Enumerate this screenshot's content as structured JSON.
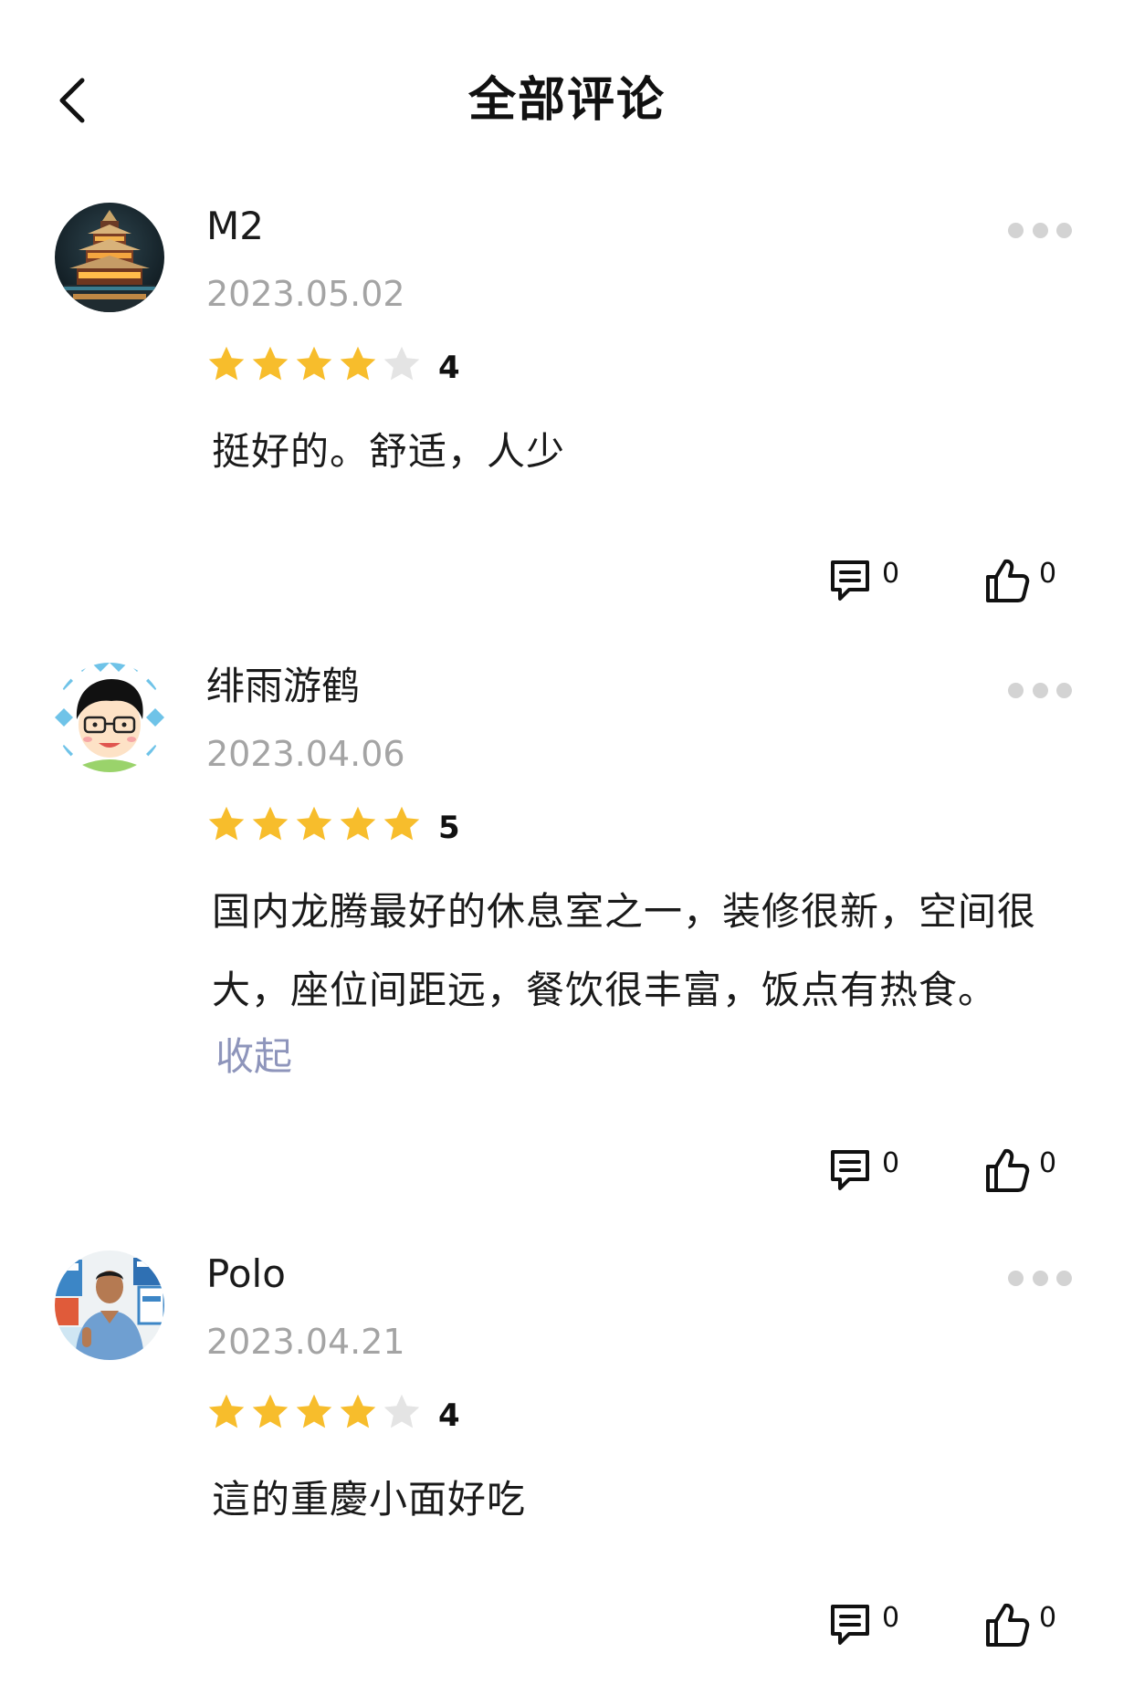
{
  "header": {
    "title": "全部评论",
    "back_icon": "chevron-left-icon"
  },
  "colors": {
    "star_filled": "#f7bd2c",
    "star_empty": "#e4e4e4",
    "date_text": "#a4a4a4",
    "link_text": "#8e95bb",
    "more_dots": "#d3d3d3"
  },
  "reviews": [
    {
      "username": "M2",
      "date": "2023.05.02",
      "rating": 4,
      "rating_label": "4",
      "content_lines": [
        "挺好的。舒适，人少"
      ],
      "collapse_label": "",
      "comment_count": "0",
      "like_count": "0",
      "avatar": "pagoda-avatar"
    },
    {
      "username": "绯雨游鹤",
      "date": "2023.04.06",
      "rating": 5,
      "rating_label": "5",
      "content_lines": [
        "国内龙腾最好的休息室之一，装修很新，空间很",
        "大，座位间距远，餐饮很丰富，饭点有热食。"
      ],
      "collapse_label": "收起",
      "comment_count": "0",
      "like_count": "0",
      "avatar": "cartoon-boy-avatar"
    },
    {
      "username": "Polo",
      "date": "2023.04.21",
      "rating": 4,
      "rating_label": "4",
      "content_lines": [
        "這的重慶小面好吃"
      ],
      "collapse_label": "",
      "comment_count": "0",
      "like_count": "0",
      "avatar": "man-photo-avatar"
    }
  ]
}
